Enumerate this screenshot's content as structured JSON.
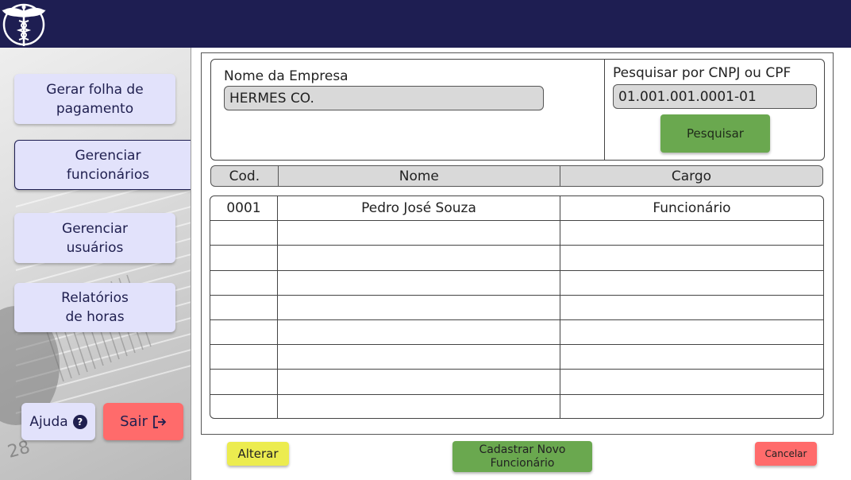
{
  "header": {
    "logo_icon": "caduceus-icon"
  },
  "sidebar": {
    "items": [
      {
        "label": "Gerar folha de\npagamento"
      },
      {
        "label": "Gerenciar\nfuncionários",
        "active": true
      },
      {
        "label": "Gerenciar\nusuários"
      },
      {
        "label": "Relatórios\nde horas"
      }
    ],
    "help_label": "Ajuda",
    "help_icon": "question-circle-icon",
    "exit_label": "Sair",
    "exit_icon": "logout-icon",
    "background_number": "28"
  },
  "company": {
    "name_label": "Nome da Empresa",
    "name_value": "HERMES CO.",
    "search_label": "Pesquisar por CNPJ ou CPF",
    "search_value": "01.001.001.0001-01",
    "search_button": "Pesquisar"
  },
  "table": {
    "headers": [
      "Cod.",
      "Nome",
      "Cargo"
    ],
    "rows": [
      [
        "0001",
        "Pedro José Souza",
        "Funcionário"
      ],
      [
        "",
        "",
        ""
      ],
      [
        "",
        "",
        ""
      ],
      [
        "",
        "",
        ""
      ],
      [
        "",
        "",
        ""
      ],
      [
        "",
        "",
        ""
      ],
      [
        "",
        "",
        ""
      ],
      [
        "",
        "",
        ""
      ],
      [
        "",
        "",
        ""
      ]
    ]
  },
  "actions": {
    "alterar": "Alterar",
    "cadastrar": "Cadastrar Novo\nFuncionário",
    "cancelar": "Cancelar"
  },
  "colors": {
    "header": "#1e1e52",
    "nav_button": "#e2e2fb",
    "search_button": "#6aa84f",
    "alterar_button": "#ecec4f",
    "cancel_button": "#ff6b6b"
  }
}
